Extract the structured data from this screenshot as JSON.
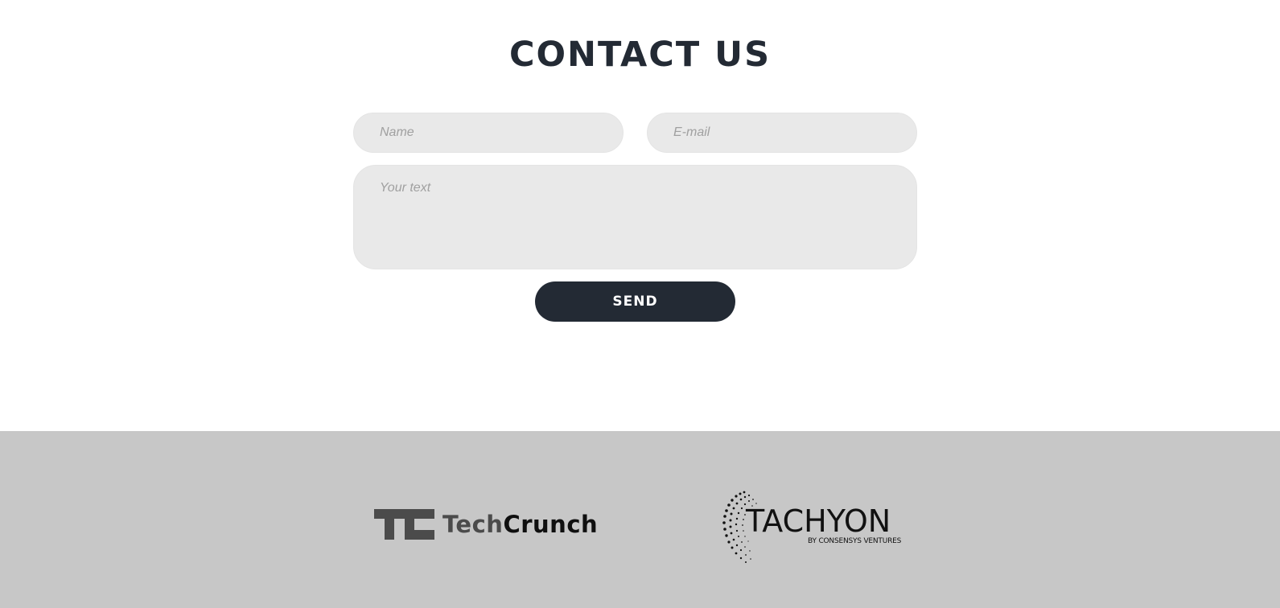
{
  "contact": {
    "title": "CONTACT US",
    "name_placeholder": "Name",
    "email_placeholder": "E-mail",
    "text_placeholder": "Your text",
    "send_label": "SEND"
  },
  "footer": {
    "logos": [
      {
        "tech": "Tech",
        "crunch": "Crunch",
        "icon": "techcrunch-logo"
      },
      {
        "name": "TACHYON",
        "sub": "BY CONSENSYS VENTURES",
        "icon": "tachyon-logo"
      }
    ]
  },
  "colors": {
    "dark": "#232a34",
    "field_bg": "#e9e9e9",
    "footer_bg": "#c7c7c7"
  }
}
